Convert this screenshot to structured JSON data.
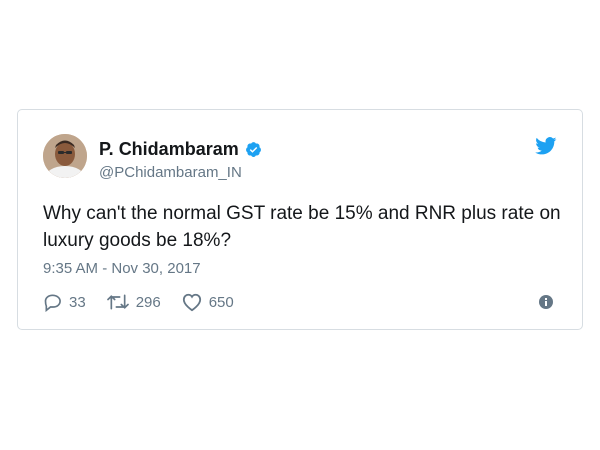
{
  "tweet": {
    "author": {
      "display_name": "P. Chidambaram",
      "handle": "@PChidambaram_IN",
      "verified": true
    },
    "text": "Why can't the normal GST rate be 15% and RNR plus rate on luxury goods be 18%?",
    "timestamp": "9:35 AM - Nov 30, 2017",
    "actions": {
      "replies": "33",
      "retweets": "296",
      "likes": "650"
    }
  },
  "icons": {
    "brand": "twitter-bird-icon",
    "verified": "verified-badge-icon",
    "reply": "reply-icon",
    "retweet": "retweet-icon",
    "like": "heart-icon",
    "info": "info-icon"
  },
  "colors": {
    "brand_blue": "#1da1f2",
    "text": "#14171a",
    "secondary": "#657786",
    "border": "#d7dde2"
  }
}
